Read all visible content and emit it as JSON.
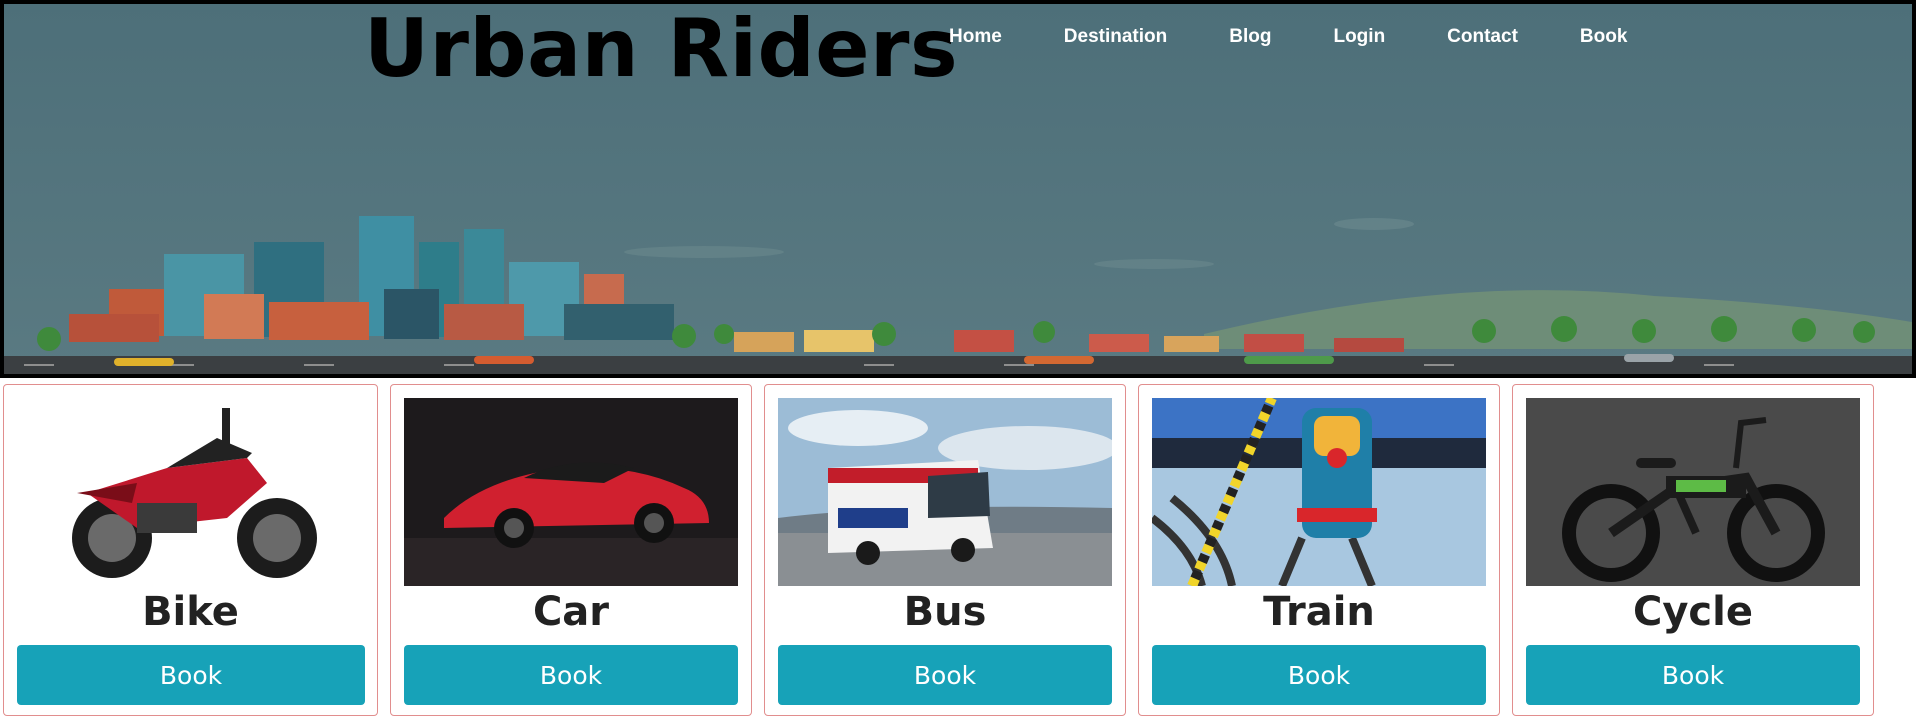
{
  "header": {
    "brand": "Urban Riders",
    "nav": [
      "Home",
      "Destination",
      "Blog",
      "Login",
      "Contact",
      "Book"
    ]
  },
  "vehicles": [
    {
      "title": "Bike",
      "button": "Book",
      "image": "motorcycle-image"
    },
    {
      "title": "Car",
      "button": "Book",
      "image": "sports-car-image"
    },
    {
      "title": "Bus",
      "button": "Book",
      "image": "bus-image"
    },
    {
      "title": "Train",
      "button": "Book",
      "image": "train-image"
    },
    {
      "title": "Cycle",
      "button": "Book",
      "image": "electric-bicycle-image"
    }
  ],
  "colors": {
    "hero_bg": "#4f737e",
    "button": "#17a2b8",
    "card_border": "#e18e8e"
  }
}
